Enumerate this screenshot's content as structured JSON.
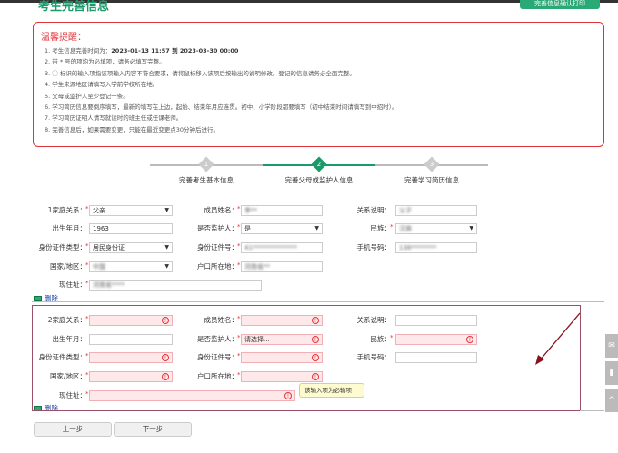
{
  "header": {
    "title": "考生完善信息",
    "print_button": "完善信息确认打印"
  },
  "notice": {
    "title": "温馨提醒：",
    "items": [
      {
        "pre": "1. 考生信息完善时间为：",
        "bold": "2023-01-13 11:57 到 2023-03-30 00:00"
      },
      {
        "pre": "2. 带 * 号的项均为必填项，请务必填写完整。"
      },
      {
        "pre": "3. ⓘ 标识的输入项指该项输入内容不符合要求，请将鼠标移入该项后按输出的说明修改。登记的信息请务必全面完整。"
      },
      {
        "pre": "4. 学生来源地区请填写入学前学校所在地。"
      },
      {
        "pre": "5. 父母或监护人至少登记一条。"
      },
      {
        "pre": "6. 学习简历信息要倒序填写，最新的填写在上边，起始、结束年月应连贯。初中、小学阶段都要填写（初中结束时间请填写到中招时）。"
      },
      {
        "pre": "7. 学习简历证明人请写就读时的班主任或任课老师。"
      },
      {
        "pre": "8. 完善信息后，如果需要变更，只能在最近变更点30分钟后进行。"
      }
    ]
  },
  "steps": [
    {
      "num": "1",
      "label": "完善考生基本信息",
      "active": false
    },
    {
      "num": "2",
      "label": "完善父母或监护人信息",
      "active": true
    },
    {
      "num": "3",
      "label": "完善学习简历信息",
      "active": false
    }
  ],
  "colors": {
    "accent": "#2aa876",
    "error": "#e0343a"
  },
  "members": [
    {
      "delete": "删除",
      "fields": [
        {
          "label": "1家庭关系：",
          "req": true,
          "value": "父亲",
          "type": "select"
        },
        {
          "label": "成员姓名：",
          "req": true,
          "value": "李**",
          "type": "text",
          "blur": true
        },
        {
          "label": "关系说明：",
          "req": false,
          "value": "父子",
          "type": "text",
          "blur": true
        },
        {
          "label": "出生年月：",
          "req": false,
          "value": "1963",
          "type": "text"
        },
        {
          "label": "是否监护人：",
          "req": true,
          "value": "是",
          "type": "select"
        },
        {
          "label": "民族：",
          "req": true,
          "value": "汉族",
          "type": "select",
          "blur": true
        },
        {
          "label": "身份证件类型：",
          "req": true,
          "value": "居民身份证",
          "type": "select"
        },
        {
          "label": "身份证件号：",
          "req": true,
          "value": "41**************",
          "type": "text",
          "blur": true
        },
        {
          "label": "手机号码：",
          "req": false,
          "value": "138********",
          "type": "text",
          "blur": true
        },
        {
          "label": "国家/地区：",
          "req": true,
          "value": "中国",
          "type": "select",
          "blur": true
        },
        {
          "label": "户口所在地：",
          "req": true,
          "value": "河南省**",
          "type": "text",
          "blur": true
        },
        null,
        {
          "label": "现住址：",
          "req": true,
          "value": "河南省****",
          "type": "text",
          "blur": true
        }
      ]
    },
    {
      "delete": "删除",
      "fields": [
        {
          "label": "2家庭关系：",
          "req": true,
          "value": "",
          "type": "select",
          "error": true
        },
        {
          "label": "成员姓名：",
          "req": true,
          "value": "",
          "type": "text",
          "error": true
        },
        {
          "label": "关系说明：",
          "req": false,
          "value": "",
          "type": "text"
        },
        {
          "label": "出生年月：",
          "req": false,
          "value": "",
          "type": "text"
        },
        {
          "label": "是否监护人：",
          "req": true,
          "value": "请选择...",
          "type": "select",
          "error": true
        },
        {
          "label": "民族：",
          "req": true,
          "value": "",
          "type": "select",
          "error": true
        },
        {
          "label": "身份证件类型：",
          "req": true,
          "value": "",
          "type": "select",
          "error": true
        },
        {
          "label": "身份证件号：",
          "req": true,
          "value": "",
          "type": "text",
          "error": true
        },
        {
          "label": "手机号码：",
          "req": false,
          "value": "",
          "type": "text"
        },
        {
          "label": "国家/地区：",
          "req": true,
          "value": "",
          "type": "select",
          "error": true
        },
        {
          "label": "户口所在地：",
          "req": true,
          "value": "",
          "type": "text",
          "error": true
        },
        null,
        {
          "label": "现住址：",
          "req": true,
          "value": "",
          "type": "text",
          "error": true
        }
      ],
      "tooltip": "该输入项为必输项"
    }
  ],
  "buttons": {
    "prev": "上一步",
    "next": "下一步"
  }
}
